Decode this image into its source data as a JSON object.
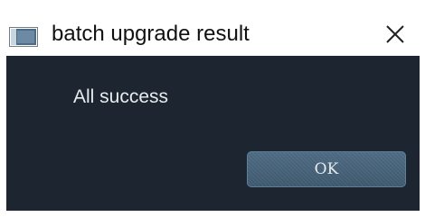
{
  "window": {
    "title": "batch upgrade result",
    "app_icon": "window-app-icon",
    "close_icon": "close-icon",
    "close_glyph": "✕"
  },
  "dialog": {
    "message": "All success",
    "ok_label": "OK"
  },
  "colors": {
    "content_background": "#1c2530",
    "button_background": "#46627a",
    "button_border": "#5c7e9a",
    "text_light": "#e8ecef"
  }
}
